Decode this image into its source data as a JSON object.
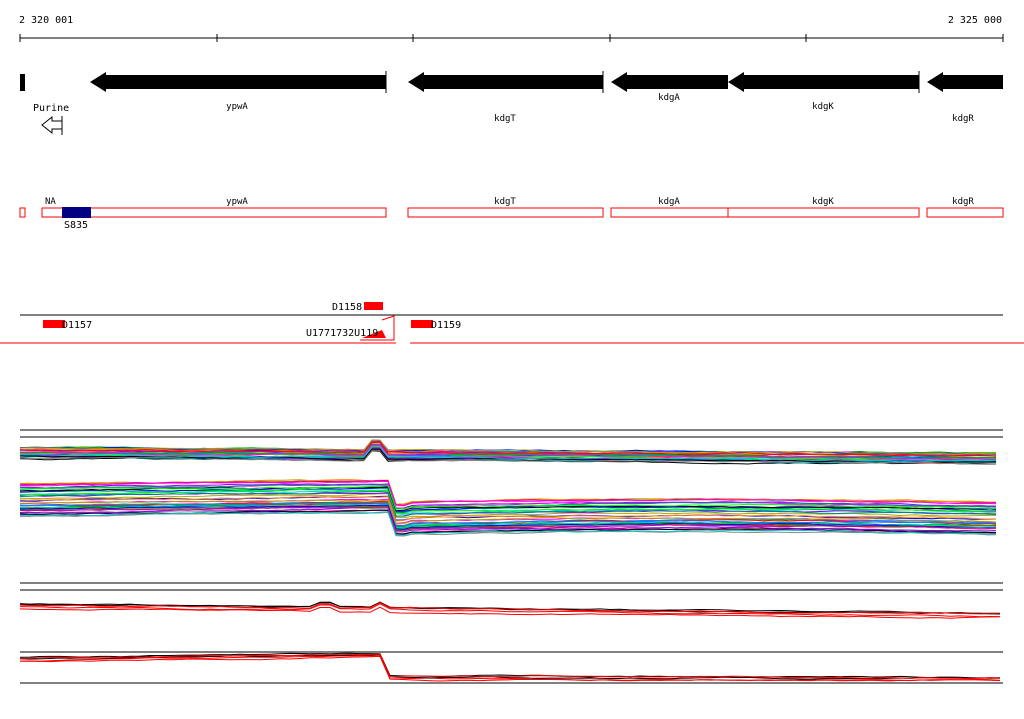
{
  "coords": {
    "start": "2 320 001",
    "end": "2 325 000"
  },
  "genes": [
    "ypwA",
    "kdgT",
    "kdgA",
    "kdgK",
    "kdgR"
  ],
  "terminator": {
    "label": "Purine"
  },
  "segments": {
    "na_label": "NA",
    "s_label": "S835"
  },
  "probes": {
    "d1157": "D1157",
    "d1158": "D1158",
    "d1159": "D1159",
    "overlap": "U1771732U119"
  },
  "colors": {
    "arrow": "#000000",
    "segment_border": "#ff0000",
    "blue_box": "#000080",
    "probe": "#ff0000"
  }
}
